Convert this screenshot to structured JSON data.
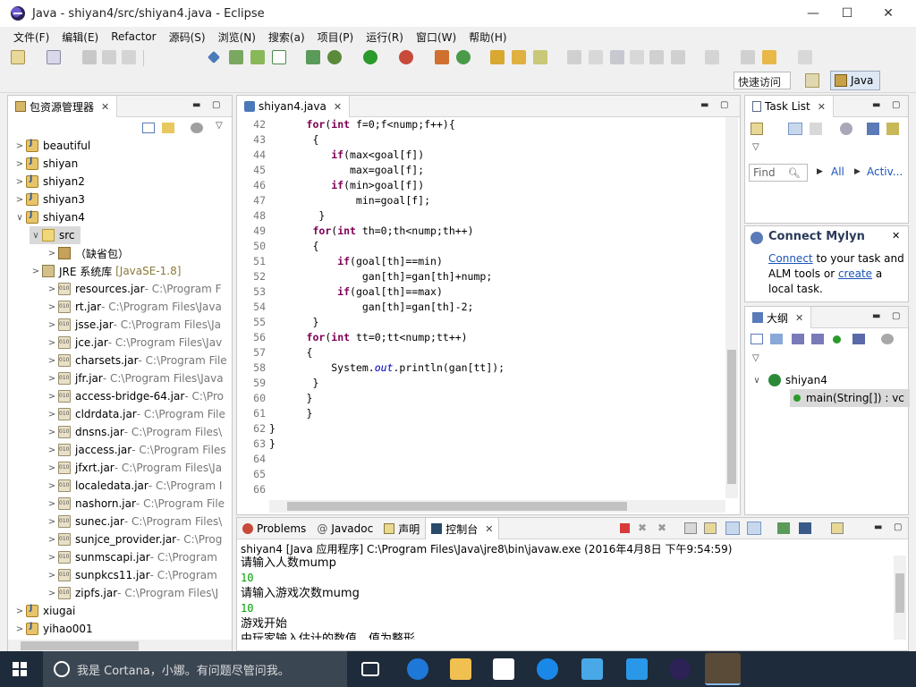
{
  "window": {
    "title": "Java - shiyan4/src/shiyan4.java - Eclipse",
    "controls": {
      "minimize": "—",
      "maximize": "☐",
      "close": "✕"
    }
  },
  "menu": [
    "文件(F)",
    "编辑(E)",
    "Refactor",
    "源码(S)",
    "浏览(N)",
    "搜索(a)",
    "项目(P)",
    "运行(R)",
    "窗口(W)",
    "帮助(H)"
  ],
  "toolbar": {
    "quick_access": "快速访问",
    "perspective": "Java"
  },
  "package_explorer": {
    "tab": "包资源管理器",
    "projects_top": [
      "beautiful",
      "shiyan",
      "shiyan2",
      "shiyan3",
      "shiyan4"
    ],
    "src": "src",
    "default_pkg": "（缺省包）",
    "jre_label": "JRE 系统库",
    "jre_version": "[JavaSE-1.8]",
    "jars": [
      {
        "name": "resources.jar",
        "path": " - C:\\Program F"
      },
      {
        "name": "rt.jar",
        "path": " - C:\\Program Files\\Java"
      },
      {
        "name": "jsse.jar",
        "path": " - C:\\Program Files\\Ja"
      },
      {
        "name": "jce.jar",
        "path": " - C:\\Program Files\\Jav"
      },
      {
        "name": "charsets.jar",
        "path": " - C:\\Program File"
      },
      {
        "name": "jfr.jar",
        "path": " - C:\\Program Files\\Java"
      },
      {
        "name": "access-bridge-64.jar",
        "path": " - C:\\Pro"
      },
      {
        "name": "cldrdata.jar",
        "path": " - C:\\Program File"
      },
      {
        "name": "dnsns.jar",
        "path": " - C:\\Program Files\\"
      },
      {
        "name": "jaccess.jar",
        "path": " - C:\\Program Files"
      },
      {
        "name": "jfxrt.jar",
        "path": " - C:\\Program Files\\Ja"
      },
      {
        "name": "localedata.jar",
        "path": " - C:\\Program I"
      },
      {
        "name": "nashorn.jar",
        "path": " - C:\\Program File"
      },
      {
        "name": "sunec.jar",
        "path": " - C:\\Program Files\\"
      },
      {
        "name": "sunjce_provider.jar",
        "path": " - C:\\Prog"
      },
      {
        "name": "sunmscapi.jar",
        "path": " - C:\\Program"
      },
      {
        "name": "sunpkcs11.jar",
        "path": " - C:\\Program"
      },
      {
        "name": "zipfs.jar",
        "path": " - C:\\Program Files\\J"
      }
    ],
    "projects_bottom": [
      "xiugai",
      "yihao001"
    ]
  },
  "editor": {
    "tab": "shiyan4.java",
    "lines": [
      {
        "n": "42",
        "code": [
          [
            "      ",
            ""
          ],
          [
            "for",
            "kw"
          ],
          [
            "(",
            ""
          ],
          [
            "int",
            "kw"
          ],
          [
            " f=0;f<nump;f++){",
            ""
          ]
        ]
      },
      {
        "n": "43",
        "code": [
          [
            "       {",
            ""
          ]
        ]
      },
      {
        "n": "44",
        "code": [
          [
            "          ",
            ""
          ],
          [
            "if",
            "kw"
          ],
          [
            "(max<goal[f])",
            ""
          ]
        ]
      },
      {
        "n": "45",
        "code": [
          [
            "             max=goal[f];",
            ""
          ]
        ]
      },
      {
        "n": "46",
        "code": [
          [
            "          ",
            ""
          ],
          [
            "if",
            "kw"
          ],
          [
            "(min>goal[f])",
            ""
          ]
        ]
      },
      {
        "n": "47",
        "code": [
          [
            "              min=goal[f];",
            ""
          ]
        ]
      },
      {
        "n": "48",
        "code": [
          [
            "        }",
            ""
          ]
        ]
      },
      {
        "n": "49",
        "code": [
          [
            "       ",
            ""
          ],
          [
            "for",
            "kw"
          ],
          [
            "(",
            ""
          ],
          [
            "int",
            "kw"
          ],
          [
            " th=0;th<nump;th++)",
            ""
          ]
        ]
      },
      {
        "n": "50",
        "code": [
          [
            "       {",
            ""
          ]
        ]
      },
      {
        "n": "51",
        "code": [
          [
            "           ",
            ""
          ],
          [
            "if",
            "kw"
          ],
          [
            "(goal[th]==min)",
            ""
          ]
        ]
      },
      {
        "n": "52",
        "code": [
          [
            "               gan[th]=gan[th]+nump;",
            ""
          ]
        ]
      },
      {
        "n": "53",
        "code": [
          [
            "           ",
            ""
          ],
          [
            "if",
            "kw"
          ],
          [
            "(goal[th]==max)",
            ""
          ]
        ]
      },
      {
        "n": "54",
        "code": [
          [
            "               gan[th]=gan[th]-2;",
            ""
          ]
        ]
      },
      {
        "n": "55",
        "code": [
          [
            "       }",
            ""
          ]
        ]
      },
      {
        "n": "56",
        "code": [
          [
            "      ",
            ""
          ],
          [
            "for",
            "kw"
          ],
          [
            "(",
            ""
          ],
          [
            "int",
            "kw"
          ],
          [
            " tt=0;tt<nump;tt++)",
            ""
          ]
        ]
      },
      {
        "n": "57",
        "code": [
          [
            "      {",
            ""
          ]
        ]
      },
      {
        "n": "58",
        "code": [
          [
            "          System.",
            ""
          ],
          [
            "out",
            "fld"
          ],
          [
            ".println(gan[tt]);",
            ""
          ]
        ]
      },
      {
        "n": "59",
        "code": [
          [
            "       }",
            ""
          ]
        ]
      },
      {
        "n": "60",
        "code": [
          [
            "      }",
            ""
          ]
        ]
      },
      {
        "n": "61",
        "code": [
          [
            "      }",
            ""
          ]
        ]
      },
      {
        "n": "62",
        "code": [
          [
            "}",
            ""
          ]
        ]
      },
      {
        "n": "63",
        "code": [
          [
            "}",
            ""
          ]
        ]
      },
      {
        "n": "64",
        "code": [
          [
            "",
            ""
          ]
        ]
      },
      {
        "n": "65",
        "code": [
          [
            "",
            ""
          ]
        ]
      },
      {
        "n": "66",
        "code": [
          [
            "",
            ""
          ]
        ]
      }
    ]
  },
  "task_list": {
    "tab": "Task List",
    "find_placeholder": "Find",
    "all": "All",
    "activate": "Activ..."
  },
  "mylyn": {
    "title": "Connect Mylyn",
    "connect": "Connect",
    "text1": " to your task and",
    "text2": "ALM tools or ",
    "create": "create",
    "text3": " a",
    "text4": "local task."
  },
  "outline": {
    "tab": "大纲",
    "class": "shiyan4",
    "method": "main(String[]) : vc"
  },
  "bottom_tabs": [
    "Problems",
    "Javadoc",
    "声明",
    "控制台"
  ],
  "console": {
    "header": "shiyan4 [Java 应用程序] C:\\Program Files\\Java\\jre8\\bin\\javaw.exe (2016年4月8日 下午9:54:59)",
    "lines": [
      {
        "text": "请输入人数mump",
        "type": "out"
      },
      {
        "text": "10",
        "type": "in"
      },
      {
        "text": "请输入游戏次数mumg",
        "type": "out"
      },
      {
        "text": "10",
        "type": "in"
      },
      {
        "text": "游戏开始",
        "type": "out"
      },
      {
        "text": "由玩家输入估计的数值，值为整形",
        "type": "out"
      }
    ]
  },
  "taskbar": {
    "cortana": "我是 Cortana，小娜。有问题尽管问我。"
  },
  "colors": {
    "keyword": "#7f0055",
    "field": "#0000c0",
    "console_input": "#00a000",
    "taskbar": "#1e2b3a",
    "link": "#1a55b8"
  }
}
